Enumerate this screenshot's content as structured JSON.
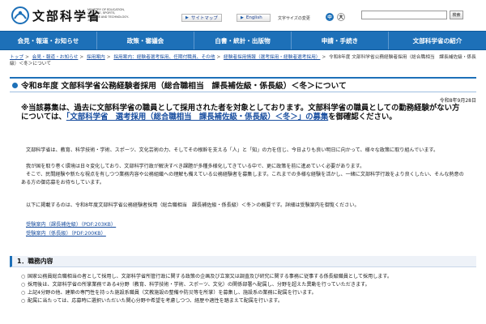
{
  "header": {
    "logo_text": "文部科学省",
    "logo_en": [
      "MINISTRY OF EDUCATION,",
      "CULTURE, SPORTS,",
      "SCIENCE AND TECHNOLOGY-JAPAN"
    ],
    "sitemap_label": "サイトマップ",
    "english_label": "English",
    "font_size_label": "文字サイズの変更",
    "font_size_medium": "中",
    "font_size_large": "大",
    "search_placeholder": "",
    "search_button": "検索"
  },
  "nav": {
    "items": [
      {
        "label": "会見・報道・お知らせ"
      },
      {
        "label": "政策・審議会"
      },
      {
        "label": "白書・統計・出版物"
      },
      {
        "label": "申請・手続き"
      },
      {
        "label": "文部科学省の紹介"
      }
    ]
  },
  "breadcrumb": {
    "items": [
      "トップ",
      "会見・報道・お知らせ",
      "採用案内",
      "採用案内：経験者選考採用、任期付職員、その他",
      "経験者採用情報（選考採用・経験者選考採用）"
    ],
    "current": "令和8年度 文部科学省公務経験者採用（総合職相当　課長補佐級・係長級）＜冬＞について"
  },
  "main": {
    "title": "令和8年度 文部科学省公務経験者採用（総合職相当　課長補佐級・係長級）＜冬＞について",
    "date": "令和8年9月28日",
    "notice_before": "※当該募集は、過去に文部科学省の職員として採用された者を対象としております。文部科学省の職員としての勤務経験がない方については、",
    "notice_link": "「文部科学省　選考採用（総合職相当　課長補佐級・係長級）＜冬＞」の募集",
    "notice_after": "を御確認ください。",
    "paragraph_1": "文部科学省は、教育、科学技術・学術、スポーツ、文化芸術の力、そしてその根幹を支える「人」と「知」の力を信じ、今日よりも良い明日に向かって、様々な政策に取り組んでいます。",
    "paragraph_2": "我が国を取り巻く環境は日々変化しており、文部科学行政が解決すべき課題が多種多様化してきている中で、更に政策を前に進めていく必要があります。",
    "paragraph_3": "そこで、民間経験や新たな視点を有しつつ業務内容や公務組織への理解も備えている公務経験者を募集します。これまでの多様な経験を活かし、一緒に文部科学行政をより良くしたい、そんな熱意のある方の御応募をお待ちしています。",
    "paragraph_4": "以下に掲載するのは、令和8年度文部科学省公務経験者採用（総合職相当　課長補佐級・係長級）＜冬＞の概要です。詳細は受験案内を御覧ください。",
    "links": [
      {
        "label": "受験案内（課長補佐級）",
        "meta": "（PDF:203KB）"
      },
      {
        "label": "受験案内（係長級）",
        "meta": "（PDF:200KB）"
      }
    ]
  },
  "section_1": {
    "heading": "1．職務内容",
    "items": [
      "国家公務員総合職相当の者として採用し、文部科学省所管行政に関する政策の企画及び立案又は調査及び研究に関する事務に従事する係長級職員として採用します。",
      "採用後は、文部科学省の所掌業務である4分野（教育、科学技術・学術、スポーツ、文化）の関係部署へ配属し、分野を超えた異動を行っていただきます。",
      "上記4分野の他、建築の専門性を持った施設系職員（文教施設の整備や防災等を所掌）を募集し、施設系の業務に配属を行います。",
      "配属に当たっては、応募時に選択いただいた関心分野や希望を考慮しつつ、経歴や適性を踏まえて配属を行います。"
    ]
  },
  "colors": {
    "nav_blue": "#1d70b8",
    "link_blue": "#1a4fa0"
  }
}
